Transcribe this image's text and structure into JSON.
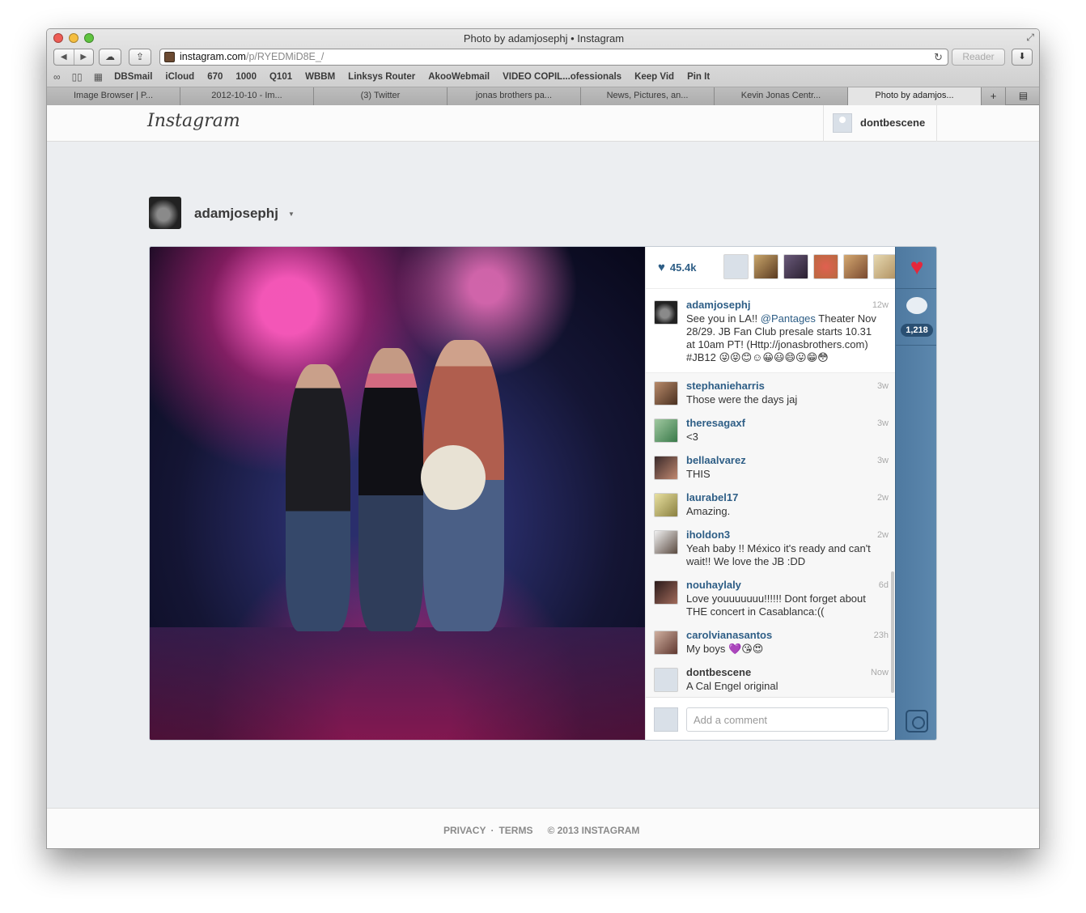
{
  "window": {
    "title": "Photo by adamjosephj • Instagram",
    "url_host": "instagram.com",
    "url_path": "/p/RYEDMiD8E_/",
    "reader_label": "Reader"
  },
  "bookmarks": [
    "DBSmail",
    "iCloud",
    "670",
    "1000",
    "Q101",
    "WBBM",
    "Linksys Router",
    "AkooWebmail",
    "VIDEO COPIL...ofessionals",
    "Keep Vid",
    "Pin It"
  ],
  "tabs": [
    {
      "label": "Image Browser | P...",
      "active": false
    },
    {
      "label": "2012-10-10 - Im...",
      "active": false
    },
    {
      "label": "(3) Twitter",
      "active": false
    },
    {
      "label": "jonas brothers pa...",
      "active": false
    },
    {
      "label": "News, Pictures, an...",
      "active": false
    },
    {
      "label": "Kevin Jonas Centr...",
      "active": false
    },
    {
      "label": "Photo by adamjos...",
      "active": true
    }
  ],
  "header": {
    "logo": "Instagram",
    "current_user": "dontbescene"
  },
  "owner": {
    "username": "adamjosephj"
  },
  "post": {
    "likes": "45.4k",
    "caption": {
      "user": "adamjosephj",
      "time": "12w",
      "text_before": "See you in LA!! ",
      "mention": "@Pantages",
      "text_after": " Theater Nov 28/29. JB Fan Club presale starts 10.31 at 10am PT! (Http://jonasbrothers.com) #JB12 😜😝😊☺😀😃😄😛😁😳"
    },
    "comments": [
      {
        "user": "stephanieharris",
        "time": "3w",
        "text": "Those were the days jaj"
      },
      {
        "user": "theresagaxf",
        "time": "3w",
        "text": "<3"
      },
      {
        "user": "bellaalvarez",
        "time": "3w",
        "text": "THIS"
      },
      {
        "user": "laurabel17",
        "time": "2w",
        "text": "Amazing."
      },
      {
        "user": "iholdon3",
        "time": "2w",
        "text": "Yeah baby !! México it's ready and can't wait!! We love the JB :DD"
      },
      {
        "user": "nouhaylaly",
        "time": "6d",
        "text": "Love youuuuuuu!!!!!! Dont forget about THE concert in Casablanca:(("
      },
      {
        "user": "carolvianasantos",
        "time": "23h",
        "text": "My boys 💜😘😍"
      },
      {
        "user": "dontbescene",
        "time": "Now",
        "text": "A Cal Engel original"
      }
    ],
    "comment_count": "1,218",
    "add_comment_placeholder": "Add a comment"
  },
  "footer": {
    "privacy": "PRIVACY",
    "terms": "TERMS",
    "copyright": "© 2013 INSTAGRAM"
  }
}
